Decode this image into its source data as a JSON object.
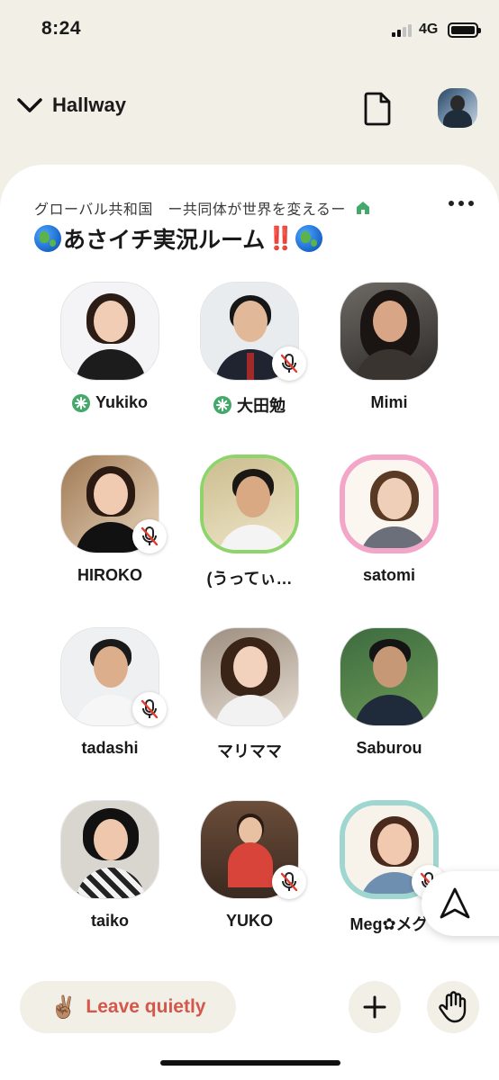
{
  "status_bar": {
    "time": "8:24",
    "network": "4G"
  },
  "header": {
    "back_label": "Hallway",
    "doc_icon": "document-icon",
    "profile_icon": "profile-avatar"
  },
  "room": {
    "club_name": "グローバル共和国　ー共同体が世界を変えるー",
    "title_text": "あさイチ実況ルーム",
    "title_emoji_left": "globe-icon",
    "title_emoji_mid": "‼️",
    "title_emoji_right": "globe-icon"
  },
  "speakers": [
    {
      "name": "Yukiko",
      "moderator": true,
      "muted": false,
      "speaking": false
    },
    {
      "name": "大田勉",
      "moderator": true,
      "muted": true,
      "speaking": false
    },
    {
      "name": "Mimi",
      "moderator": false,
      "muted": false,
      "speaking": false
    },
    {
      "name": "HIROKO",
      "moderator": false,
      "muted": true,
      "speaking": false
    },
    {
      "name": "(うってぃ…",
      "moderator": false,
      "muted": false,
      "speaking": true
    },
    {
      "name": "satomi",
      "moderator": false,
      "muted": false,
      "speaking": false
    },
    {
      "name": "tadashi",
      "moderator": false,
      "muted": true,
      "speaking": false
    },
    {
      "name": "マリママ",
      "moderator": false,
      "muted": false,
      "speaking": false
    },
    {
      "name": "Saburou",
      "moderator": false,
      "muted": false,
      "speaking": false
    },
    {
      "name": "taiko",
      "moderator": false,
      "muted": false,
      "speaking": false
    },
    {
      "name": "YUKO",
      "moderator": false,
      "muted": true,
      "speaking": false
    },
    {
      "name": "Meg✿メグ",
      "moderator": false,
      "muted": true,
      "speaking": false
    }
  ],
  "bottom_bar": {
    "leave_emoji": "✌🏽",
    "leave_label": "Leave quietly",
    "add_icon": "plus-icon",
    "raise_hand_icon": "raise-hand-icon"
  },
  "colors": {
    "background": "#f1efe6",
    "leave_text": "#d3574b",
    "moderator_green": "#43a86a",
    "speaking_ring": "#8fd46a"
  }
}
